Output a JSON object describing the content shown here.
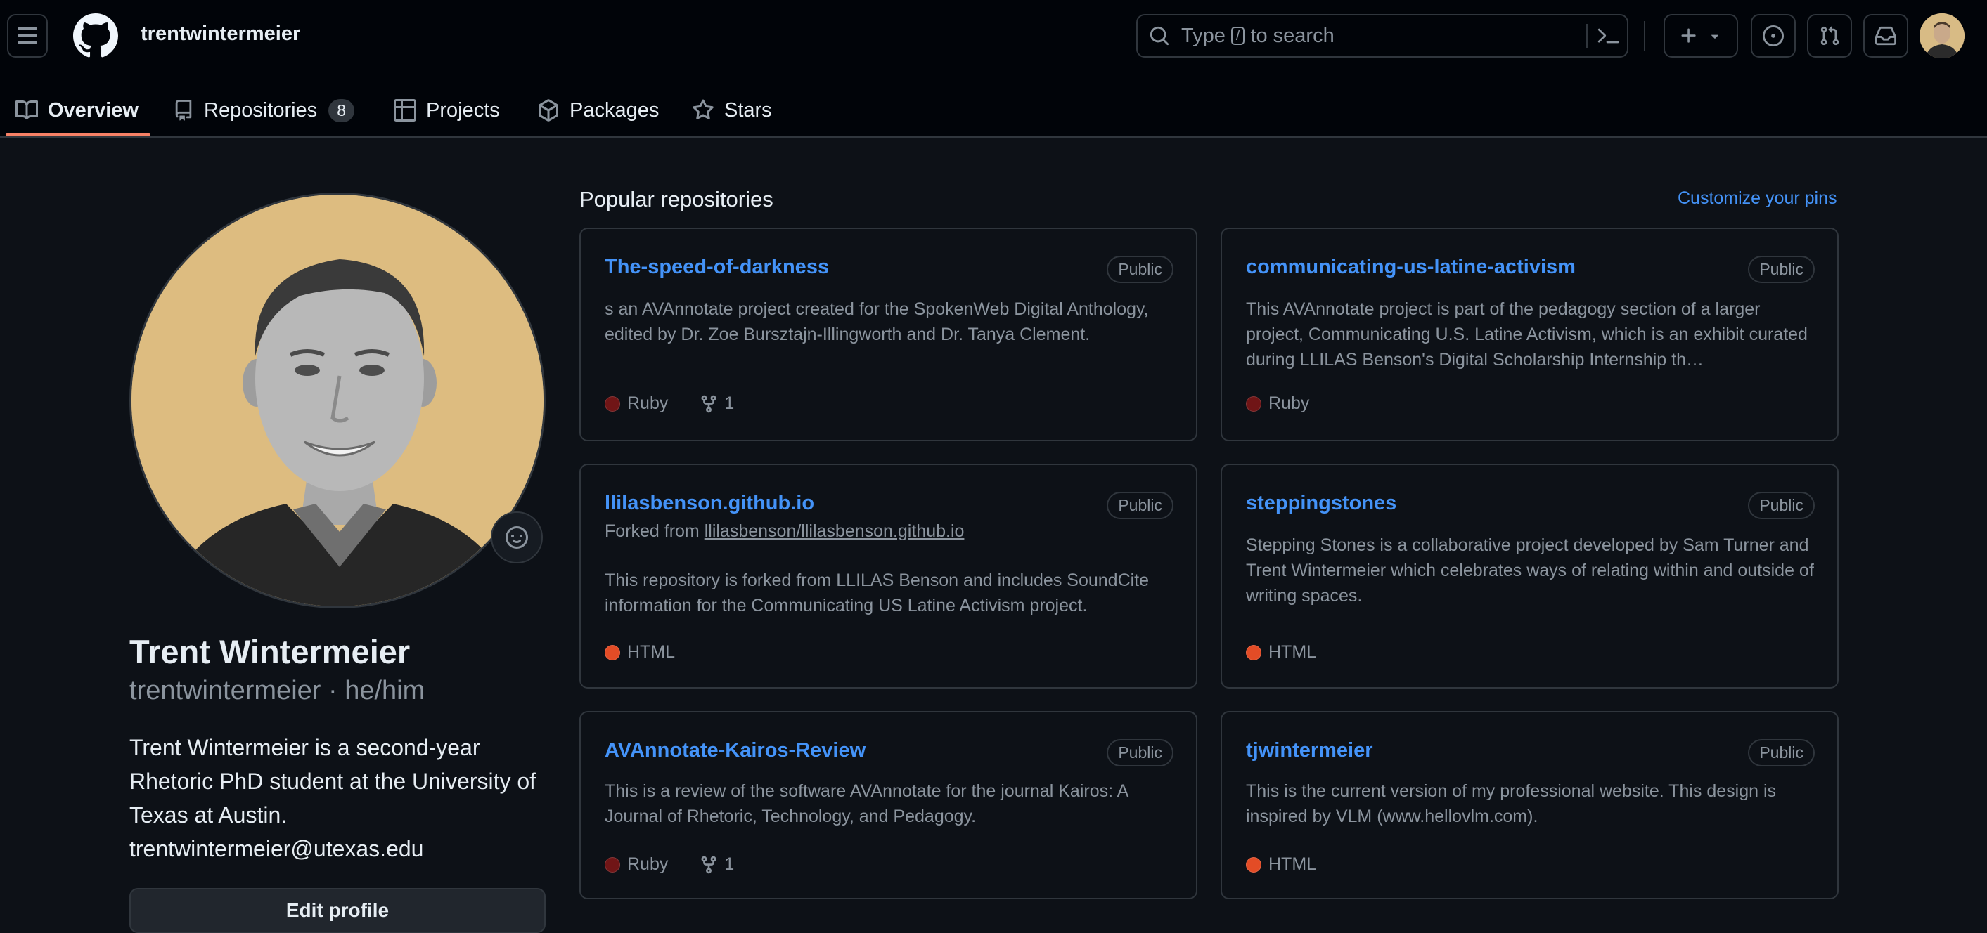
{
  "header": {
    "username": "trentwintermeier",
    "search_prefix": "Type",
    "search_key": "/",
    "search_suffix": "to search"
  },
  "tabs": [
    {
      "label": "Overview",
      "icon": "book-icon",
      "active": true
    },
    {
      "label": "Repositories",
      "icon": "repo-icon",
      "count": "8"
    },
    {
      "label": "Projects",
      "icon": "table-icon"
    },
    {
      "label": "Packages",
      "icon": "package-icon"
    },
    {
      "label": "Stars",
      "icon": "star-icon"
    }
  ],
  "profile": {
    "name": "Trent Wintermeier",
    "login": "trentwintermeier",
    "pronouns": "he/him",
    "bio": "Trent Wintermeier is a second-year Rhetoric PhD student at the University of Texas at Austin. trentwintermeier@utexas.edu",
    "edit_label": "Edit profile"
  },
  "popular": {
    "title": "Popular repositories",
    "customize_label": "Customize your pins",
    "repos": [
      {
        "name": "The-speed-of-darkness",
        "visibility": "Public",
        "description": "s an AVAnnotate project created for the SpokenWeb Digital Anthology, edited by Dr. Zoe Bursztajn-Illingworth and Dr. Tanya Clement.",
        "language": "Ruby",
        "language_color": "#701516",
        "forks": "1"
      },
      {
        "name": "communicating-us-latine-activism",
        "visibility": "Public",
        "description": "This AVAnnotate project is part of the pedagogy section of a larger project, Communicating U.S. Latine Activism, which is an exhibit curated during LLILAS Benson's Digital Scholarship Internship th…",
        "language": "Ruby",
        "language_color": "#701516"
      },
      {
        "name": "llilasbenson.github.io",
        "visibility": "Public",
        "fork_prefix": "Forked from",
        "fork_source": "llilasbenson/llilasbenson.github.io",
        "description": "This repository is forked from LLILAS Benson and includes SoundCite information for the Communicating US Latine Activism project.",
        "language": "HTML",
        "language_color": "#e34c26"
      },
      {
        "name": "steppingstones",
        "visibility": "Public",
        "description": "Stepping Stones is a collaborative project developed by Sam Turner and Trent Wintermeier which celebrates ways of relating within and outside of writing spaces.",
        "language": "HTML",
        "language_color": "#e34c26"
      },
      {
        "name": "AVAnnotate-Kairos-Review",
        "visibility": "Public",
        "description": "This is a review of the software AVAnnotate for the journal Kairos: A Journal of Rhetoric, Technology, and Pedagogy.",
        "language": "Ruby",
        "language_color": "#701516",
        "forks": "1"
      },
      {
        "name": "tjwintermeier",
        "visibility": "Public",
        "description": "This is the current version of my professional website. This design is inspired by VLM (www.hellovlm.com).",
        "language": "HTML",
        "language_color": "#e34c26"
      }
    ]
  }
}
